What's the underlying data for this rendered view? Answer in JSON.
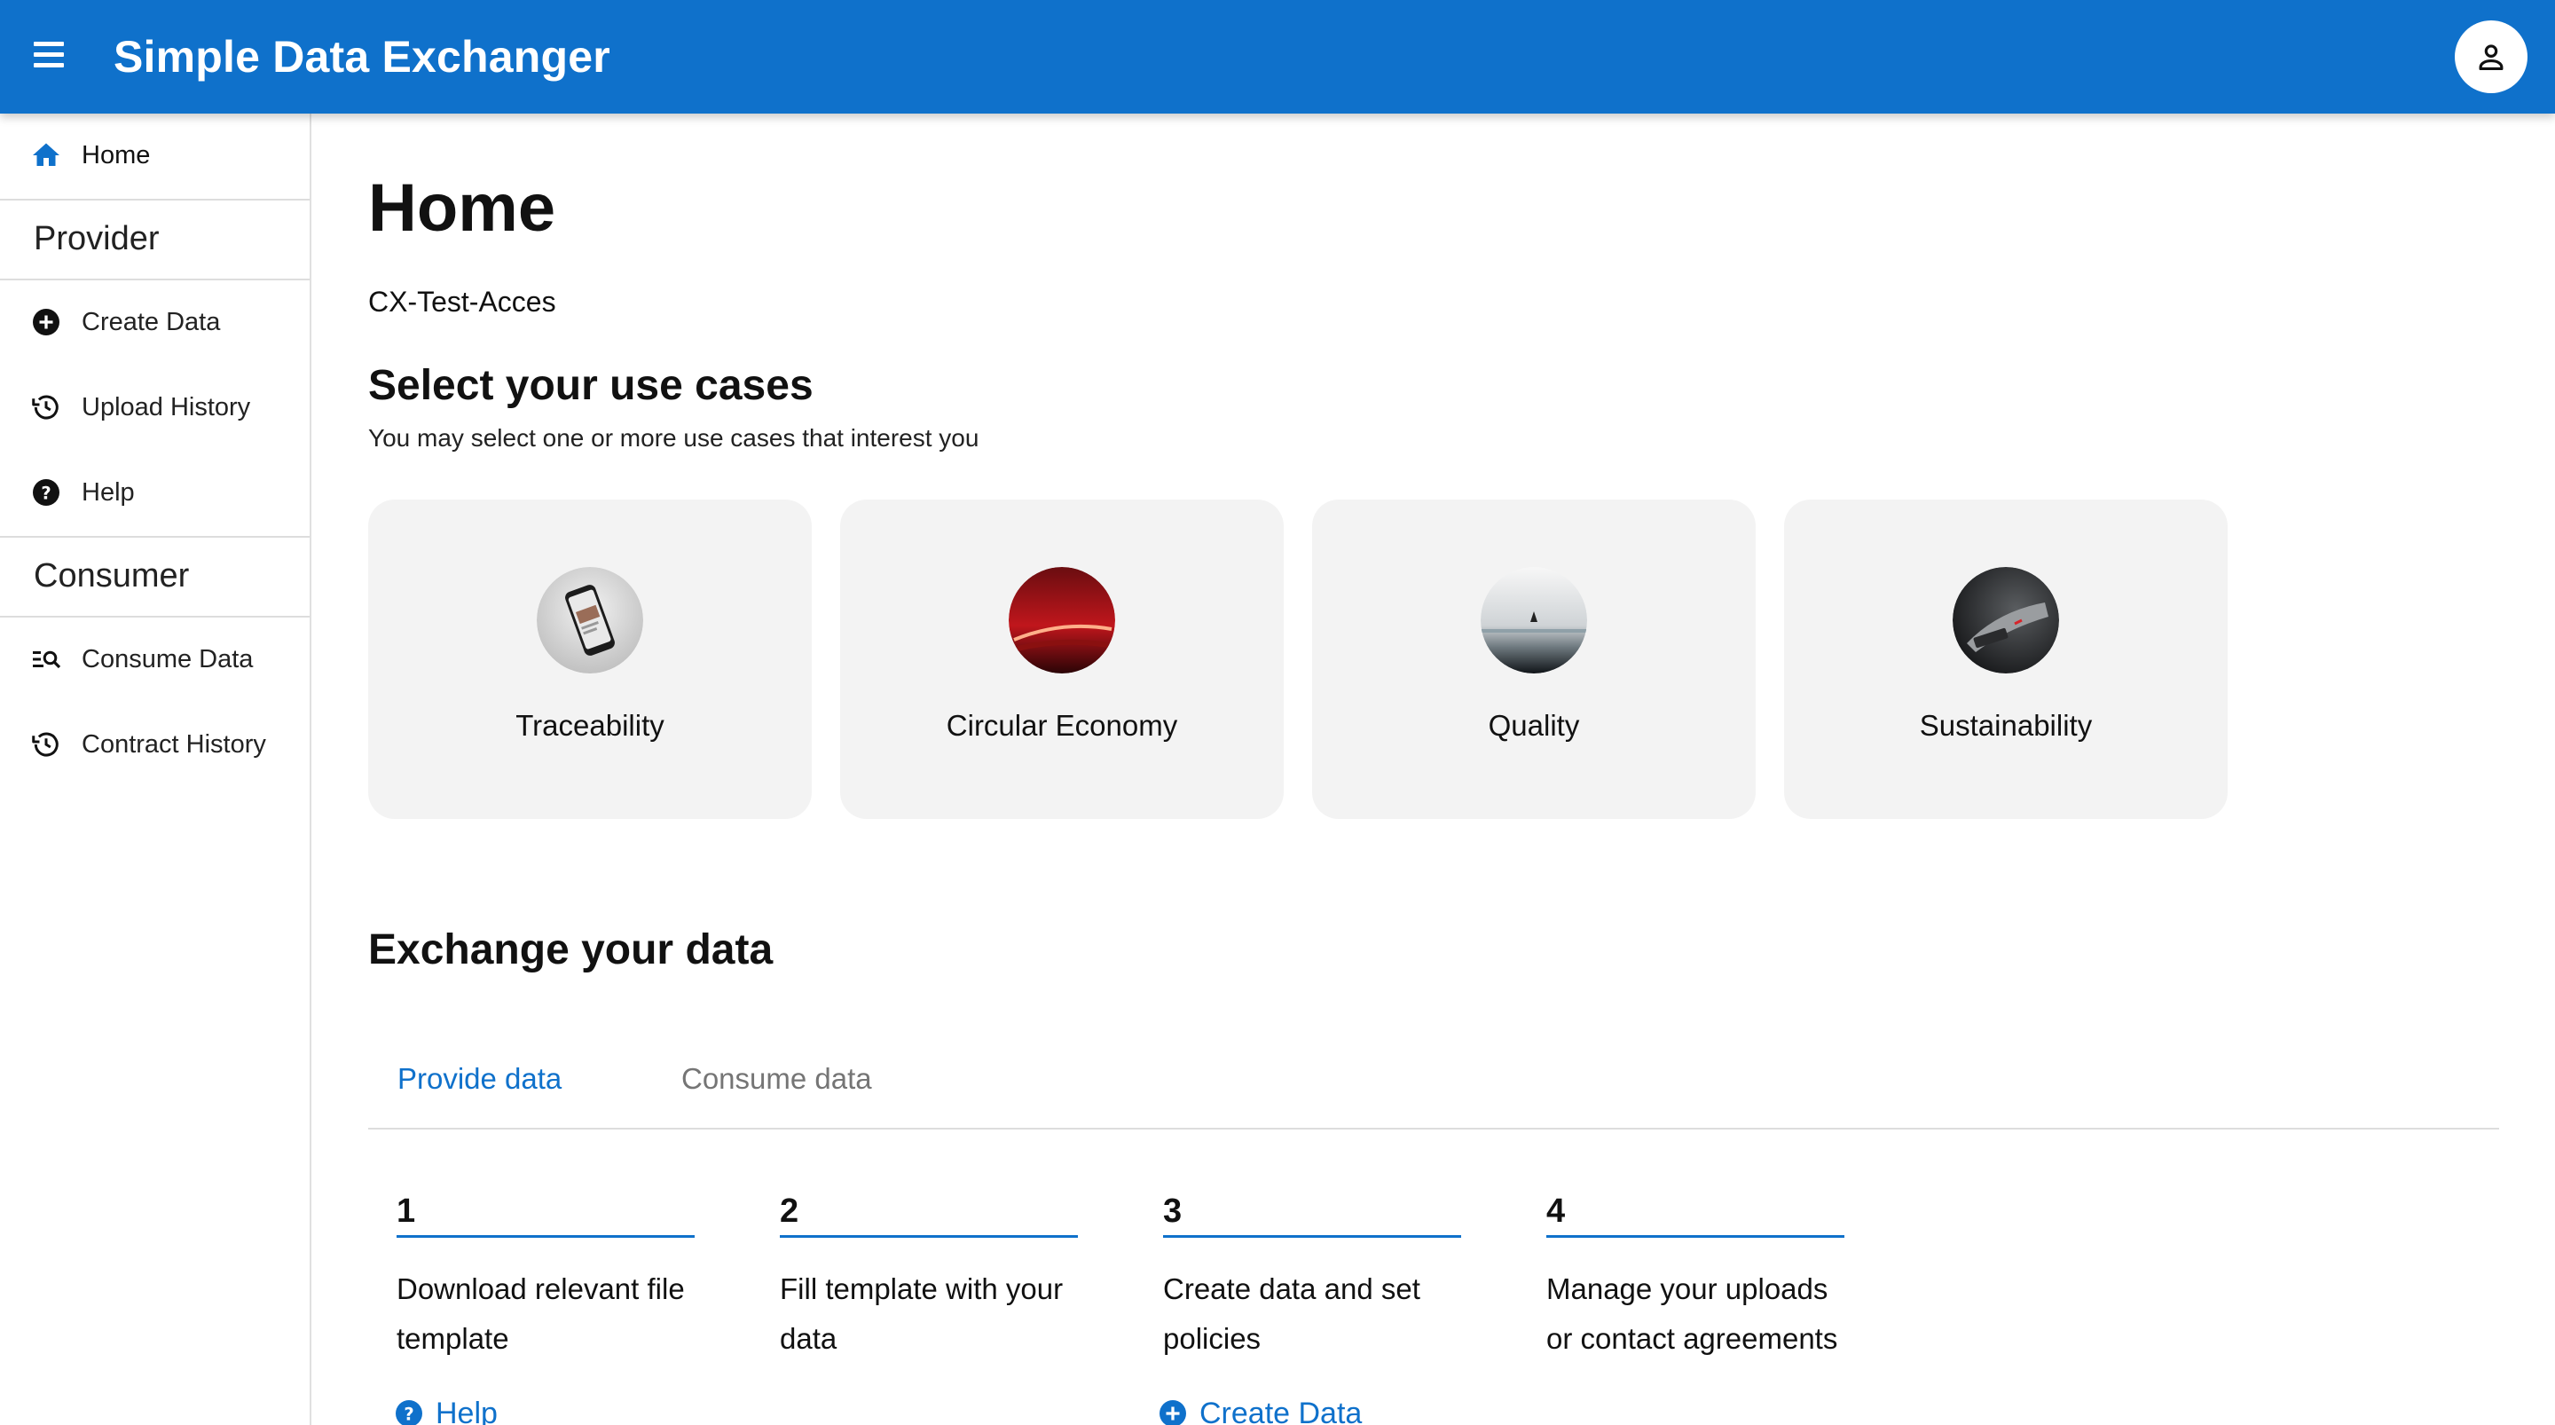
{
  "app": {
    "title": "Simple Data Exchanger",
    "brand_color": "#0f71cb",
    "menu_icon": "menu-icon",
    "user_icon": "user-icon"
  },
  "sidebar": {
    "home": {
      "label": "Home",
      "icon": "home-icon"
    },
    "provider_heading": "Provider",
    "provider_items": [
      {
        "label": "Create Data",
        "icon": "add-circle-icon"
      },
      {
        "label": "Upload History",
        "icon": "history-icon"
      },
      {
        "label": "Help",
        "icon": "help-icon"
      }
    ],
    "consumer_heading": "Consumer",
    "consumer_items": [
      {
        "label": "Consume Data",
        "icon": "manage-search-icon"
      },
      {
        "label": "Contract History",
        "icon": "history-icon"
      }
    ]
  },
  "main": {
    "title": "Home",
    "subtitle": "CX-Test-Acces",
    "use_cases": {
      "heading": "Select your use cases",
      "hint": "You may select one or more use cases that interest you",
      "cards": [
        {
          "label": "Traceability"
        },
        {
          "label": "Circular Economy"
        },
        {
          "label": "Quality"
        },
        {
          "label": "Sustainability"
        }
      ]
    },
    "exchange": {
      "heading": "Exchange your data",
      "tabs": [
        {
          "label": "Provide data",
          "active": true
        },
        {
          "label": "Consume data",
          "active": false
        }
      ],
      "steps": [
        {
          "num": "1",
          "text": "Download relevant file template",
          "link": "Help"
        },
        {
          "num": "2",
          "text": "Fill template with your data"
        },
        {
          "num": "3",
          "text": "Create data and set policies",
          "link": "Create Data"
        },
        {
          "num": "4",
          "text": "Manage your uploads or contact agreements"
        }
      ]
    }
  }
}
